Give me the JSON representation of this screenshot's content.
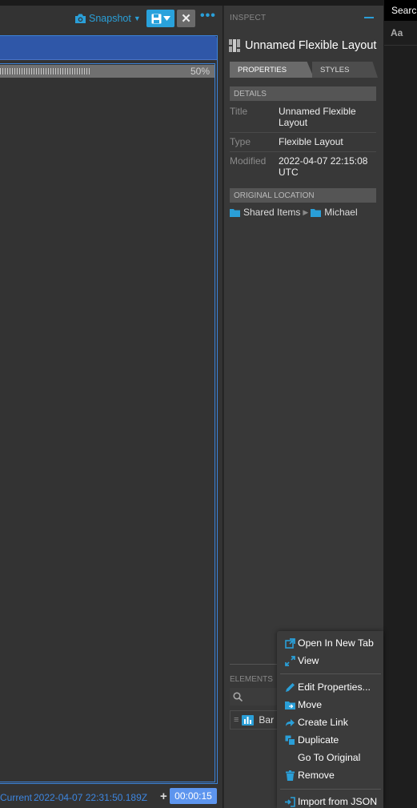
{
  "toolbar": {
    "snapshot_label": "Snapshot",
    "close_label": "✕",
    "more_label": "•••"
  },
  "layout": {
    "progress_label": "50%",
    "progress_fraction": 0.5
  },
  "status": {
    "current_label": "Current",
    "timestamp": "2022-04-07 22:31:50.189Z",
    "add_label": "+",
    "timer": "00:00:15"
  },
  "inspect": {
    "title": "INSPECT",
    "item_name": "Unnamed Flexible Layout",
    "tabs": [
      {
        "label": "PROPERTIES",
        "active": true
      },
      {
        "label": "STYLES",
        "active": false
      }
    ],
    "details_heading": "DETAILS",
    "details": [
      {
        "key": "Title",
        "value": "Unnamed Flexible Layout"
      },
      {
        "key": "Type",
        "value": "Flexible Layout"
      },
      {
        "key": "Modified",
        "value": "2022-04-07 22:15:08 UTC"
      }
    ],
    "location_heading": "ORIGINAL LOCATION",
    "location": {
      "root": "Shared Items",
      "folder": "Michael"
    },
    "elements_title": "ELEMENTS",
    "element_item": "Bar"
  },
  "right": {
    "search_label": "Search",
    "font_label": "Aa"
  },
  "context_menu": {
    "items": [
      {
        "label": "Open In New Tab",
        "icon": "external-link-icon"
      },
      {
        "label": "View",
        "icon": "expand-icon"
      },
      {
        "label": "Edit Properties...",
        "icon": "pencil-icon"
      },
      {
        "label": "Move",
        "icon": "move-icon"
      },
      {
        "label": "Create Link",
        "icon": "link-arrow-icon"
      },
      {
        "label": "Duplicate",
        "icon": "duplicate-icon"
      },
      {
        "label": "Go To Original",
        "icon": ""
      },
      {
        "label": "Remove",
        "icon": "trash-icon"
      },
      {
        "label": "Import from JSON",
        "icon": "import-icon"
      }
    ]
  },
  "colors": {
    "accent": "#2a9fd8",
    "layout_header": "#2f57a8",
    "frame_border": "#3b82d8",
    "timer_bg": "#5d95ee"
  }
}
